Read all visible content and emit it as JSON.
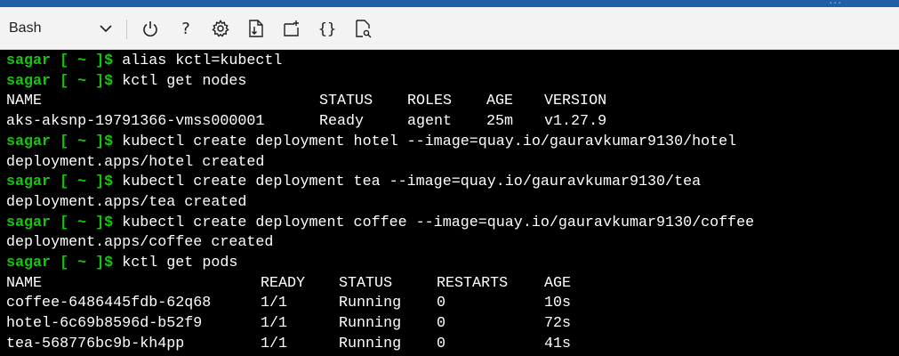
{
  "toolbar": {
    "shell": "Bash",
    "top_dots": "..."
  },
  "terminal": {
    "prompt": "sagar [ ~ ]$",
    "cmd_alias": "alias kctl=kubectl",
    "cmd_get_nodes": "kctl get nodes",
    "nodes_headers": [
      "NAME",
      "STATUS",
      "ROLES",
      "AGE",
      "VERSION"
    ],
    "nodes_rows": [
      [
        "aks-aksnp-19791366-vmss000001",
        "Ready",
        "agent",
        "25m",
        "v1.27.9"
      ]
    ],
    "cmd_create_hotel": "kubectl create deployment hotel --image=quay.io/gauravkumar9130/hotel",
    "out_hotel": "deployment.apps/hotel created",
    "cmd_create_tea": "kubectl create deployment tea --image=quay.io/gauravkumar9130/tea",
    "out_tea": "deployment.apps/tea created",
    "cmd_create_coffee": "kubectl create deployment coffee --image=quay.io/gauravkumar9130/coffee",
    "out_coffee": "deployment.apps/coffee created",
    "cmd_get_pods": "kctl get pods",
    "pods_headers": [
      "NAME",
      "READY",
      "STATUS",
      "RESTARTS",
      "AGE"
    ],
    "pods_rows": [
      [
        "coffee-6486445fdb-62q68",
        "1/1",
        "Running",
        "0",
        "10s"
      ],
      [
        "hotel-6c69b8596d-b52f9",
        "1/1",
        "Running",
        "0",
        "72s"
      ],
      [
        "tea-568776bc9b-kh4pp",
        "1/1",
        "Running",
        "0",
        "41s"
      ]
    ]
  }
}
